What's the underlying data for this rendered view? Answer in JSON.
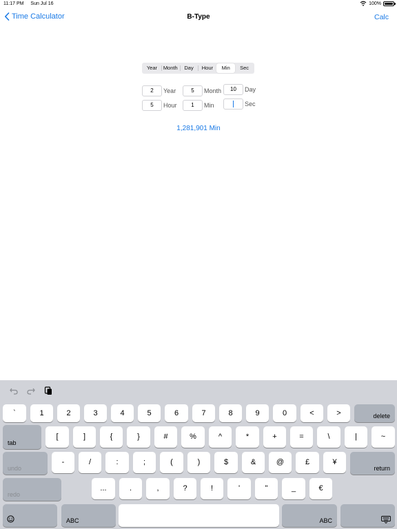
{
  "status_bar": {
    "time": "11:17 PM",
    "date": "Sun Jul 16",
    "battery": "100%"
  },
  "nav": {
    "back_label": "Time Calculator",
    "title": "B-Type",
    "action_label": "Calc"
  },
  "segments": {
    "items": [
      "Year",
      "Month",
      "Day",
      "Hour",
      "Min",
      "Sec"
    ],
    "selected": "Min"
  },
  "fields": {
    "year": {
      "value": "2",
      "label": "Year"
    },
    "month": {
      "value": "5",
      "label": "Month"
    },
    "day": {
      "value": "10",
      "label": "Day"
    },
    "hour": {
      "value": "5",
      "label": "Hour"
    },
    "min": {
      "value": "1",
      "label": "Min"
    },
    "sec": {
      "value": "",
      "label": "Sec"
    }
  },
  "result": "1,281,901 Min",
  "keyboard": {
    "row1": [
      "`",
      "1",
      "2",
      "3",
      "4",
      "5",
      "6",
      "7",
      "8",
      "9",
      "0",
      "<",
      ">"
    ],
    "row2": [
      "[",
      "]",
      "{",
      "}",
      "#",
      "%",
      "^",
      "*",
      "+",
      "=",
      "\\",
      "|",
      "~"
    ],
    "row3": [
      "-",
      "/",
      ":",
      ";",
      "(",
      ")",
      "$",
      "&",
      "@",
      "£",
      "¥"
    ],
    "row4": [
      "...",
      ".",
      ",",
      "?",
      "!",
      "'",
      "\"",
      "_",
      "€"
    ],
    "delete": "delete",
    "tab": "tab",
    "undo": "undo",
    "return": "return",
    "redo": "redo",
    "abc_left": "ABC",
    "abc_right": "ABC"
  }
}
